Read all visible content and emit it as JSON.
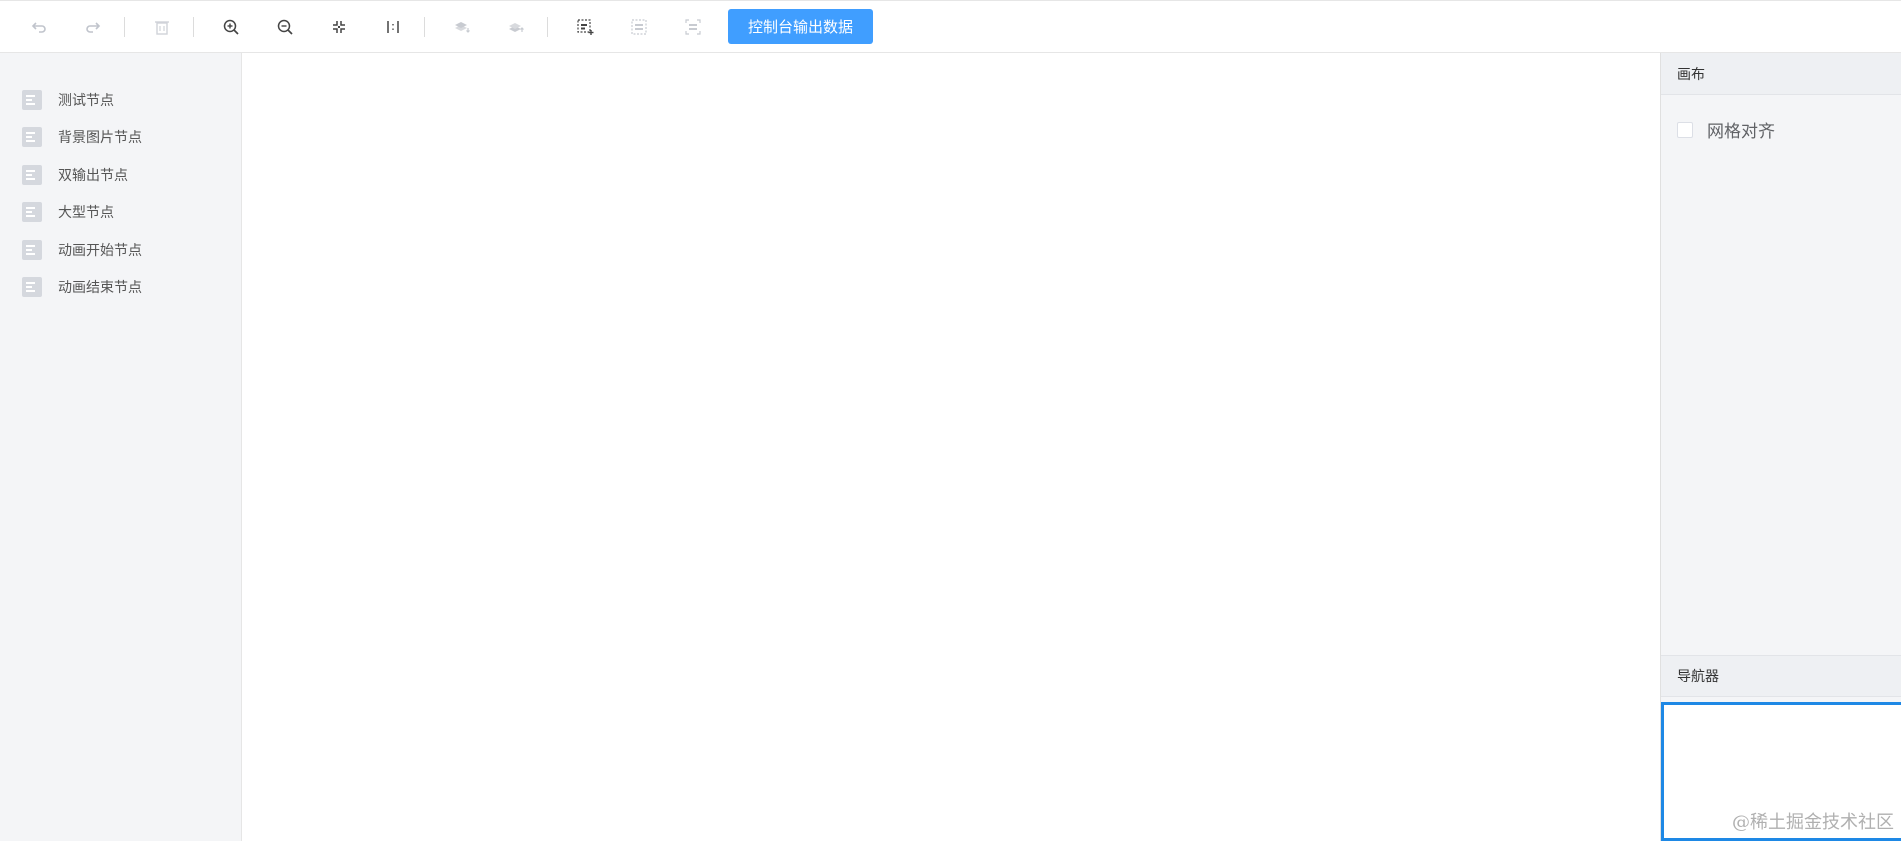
{
  "toolbar": {
    "buttons": [
      {
        "icon": "undo-icon"
      },
      {
        "icon": "redo-icon"
      },
      {
        "icon": "delete-icon"
      },
      {
        "icon": "zoom-in-icon"
      },
      {
        "icon": "zoom-out-icon"
      },
      {
        "icon": "fit-view-icon"
      },
      {
        "icon": "actual-size-icon"
      },
      {
        "icon": "bring-front-icon"
      },
      {
        "icon": "send-back-icon"
      },
      {
        "icon": "multi-select-icon"
      },
      {
        "icon": "group-icon"
      },
      {
        "icon": "ungroup-icon"
      }
    ],
    "console_button_label": "控制台输出数据",
    "accent_color": "#409eff"
  },
  "sidebar": {
    "items": [
      {
        "label": "测试节点"
      },
      {
        "label": "背景图片节点"
      },
      {
        "label": "双输出节点"
      },
      {
        "label": "大型节点"
      },
      {
        "label": "动画开始节点"
      },
      {
        "label": "动画结束节点"
      }
    ]
  },
  "right_panel": {
    "canvas_title": "画布",
    "grid_align_label": "网格对齐",
    "grid_align_checked": false,
    "navigator_title": "导航器",
    "minimap_border_color": "#1e88e5"
  },
  "watermark": "@稀土掘金技术社区"
}
